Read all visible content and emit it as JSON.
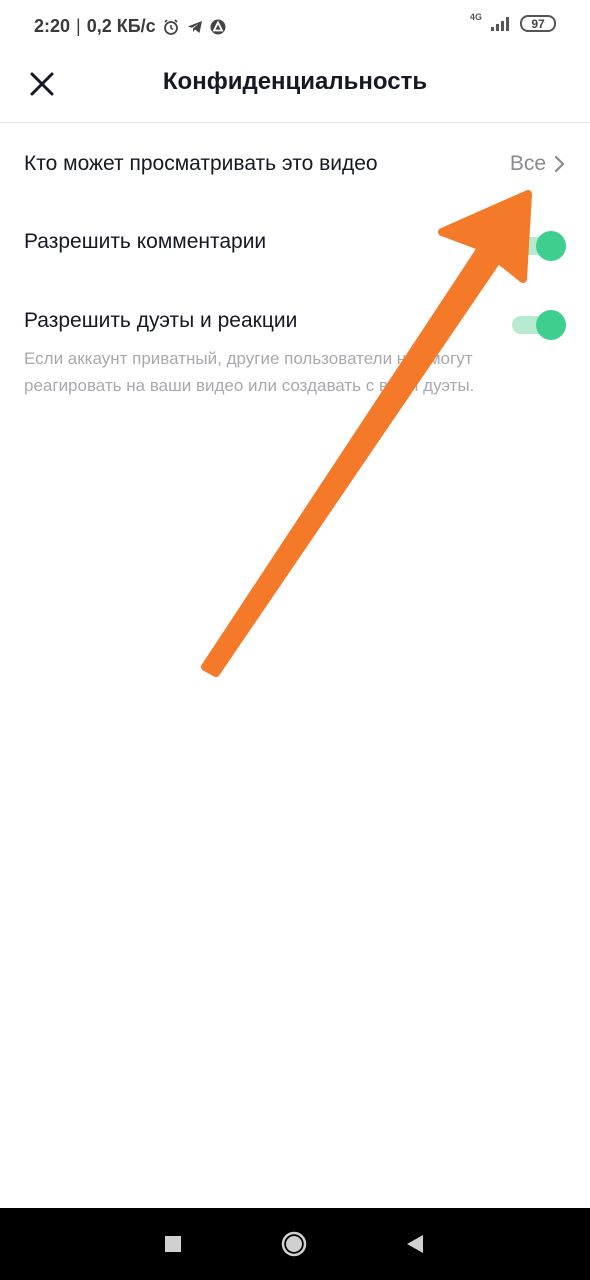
{
  "status_bar": {
    "time": "2:20",
    "separator": "|",
    "speed": "0,2 КБ/с",
    "network_type": "4G",
    "battery": "97",
    "icons": [
      "alarm-icon",
      "telegram-icon",
      "app-icon",
      "signal-icon",
      "battery-icon"
    ]
  },
  "header": {
    "title": "Конфиденциальность",
    "close_icon": "close-icon"
  },
  "settings": {
    "who_can_view": {
      "label": "Кто может просматривать это видео",
      "value": "Все"
    },
    "allow_comments": {
      "label": "Разрешить комментарии",
      "enabled": true
    },
    "allow_duets": {
      "label": "Разрешить дуэты и реакции",
      "enabled": true,
      "description": "Если аккаунт приватный, другие пользователи не смогут реагировать на ваши видео или создавать с вами дуэты."
    }
  },
  "annotation": {
    "type": "arrow",
    "color": "#f47a2a"
  },
  "colors": {
    "toggle_on": "#3ecf8e",
    "toggle_track_on": "#b6ead1",
    "title_text": "#161823",
    "secondary_text": "#8a8b91",
    "description_text": "#a8a9ae"
  },
  "nav_bar": {
    "buttons": [
      "recent-apps-button",
      "home-button",
      "back-button"
    ]
  }
}
